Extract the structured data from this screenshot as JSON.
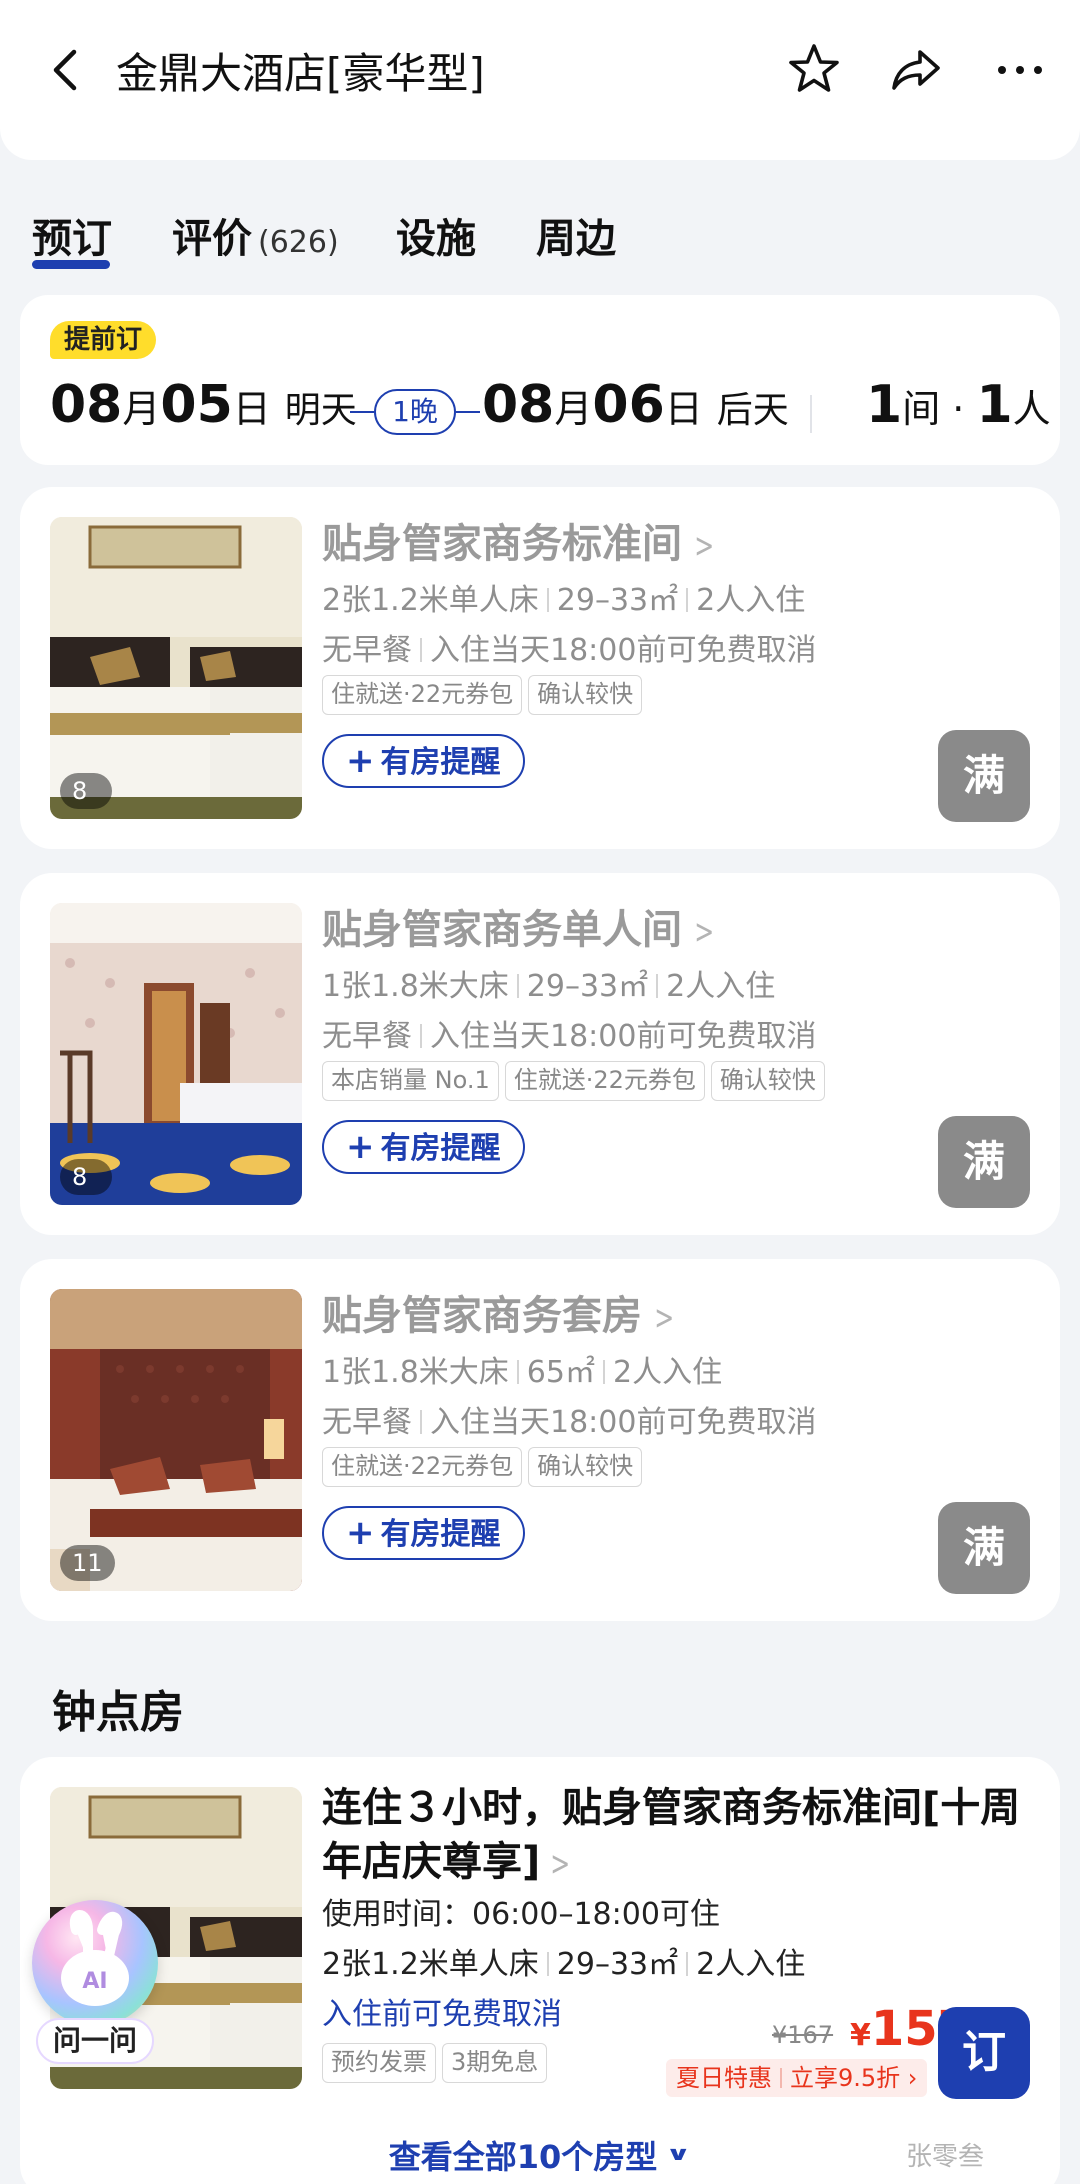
{
  "header": {
    "title": "金鼎大酒店[豪华型]"
  },
  "tabs": {
    "booking": "预订",
    "reviews": "评价",
    "reviews_count": "(626)",
    "facilities": "设施",
    "nearby": "周边"
  },
  "dates": {
    "badge": "提前订",
    "checkin": {
      "month": "08",
      "month_unit": "月",
      "day": "05",
      "day_unit": "日",
      "relative": "明天"
    },
    "nights": "1晚",
    "checkout": {
      "month": "08",
      "month_unit": "月",
      "day": "06",
      "day_unit": "日",
      "relative": "后天"
    },
    "rooms": "1",
    "rooms_unit": "间 · ",
    "guests": "1",
    "guests_unit": "人"
  },
  "rooms": [
    {
      "name": "贴身管家商务标准间",
      "bed": "2张1.2米单人床",
      "area": "29–33㎡",
      "occupancy": "2人入住",
      "breakfast": "无早餐",
      "cancel": "入住当天18:00前可免费取消",
      "tags": [
        "住就送·22元券包",
        "确认较快"
      ],
      "photo_count": "8",
      "remind_label": "有房提醒",
      "status": "满"
    },
    {
      "name": "贴身管家商务单人间",
      "bed": "1张1.8米大床",
      "area": "29–33㎡",
      "occupancy": "2人入住",
      "breakfast": "无早餐",
      "cancel": "入住当天18:00前可免费取消",
      "tags": [
        "本店销量 No.1",
        "住就送·22元券包",
        "确认较快"
      ],
      "photo_count": "8",
      "remind_label": "有房提醒",
      "status": "满"
    },
    {
      "name": "贴身管家商务套房",
      "bed": "1张1.8米大床",
      "area": "65㎡",
      "occupancy": "2人入住",
      "breakfast": "无早餐",
      "cancel": "入住当天18:00前可免费取消",
      "tags": [
        "住就送·22元券包",
        "确认较快"
      ],
      "photo_count": "11",
      "remind_label": "有房提醒",
      "status": "满"
    }
  ],
  "hourly": {
    "section_title": "钟点房",
    "name": "连住３小时，贴身管家商务标准间[十周年店庆尊享]",
    "usage_time": "使用时间：06:00–18:00可住",
    "bed": "2张1.2米单人床",
    "area": "29–33㎡",
    "occupancy": "2人入住",
    "cancel": "入住前可免费取消",
    "tags": [
      "预约发票",
      "3期免息"
    ],
    "price_old": "¥167",
    "price_currency": "¥",
    "price_new": "157",
    "promo_1": "夏日特惠",
    "promo_2": "立享9.5折",
    "book_label": "订"
  },
  "view_all": "查看全部10个房型",
  "assistant": {
    "label": "问一问"
  },
  "watermark": "张零叁",
  "colors": {
    "brand_blue": "#1e3fb0",
    "price_red": "#e8341c",
    "badge_yellow": "#ffdd2b",
    "full_gray": "#8a8a8a"
  }
}
